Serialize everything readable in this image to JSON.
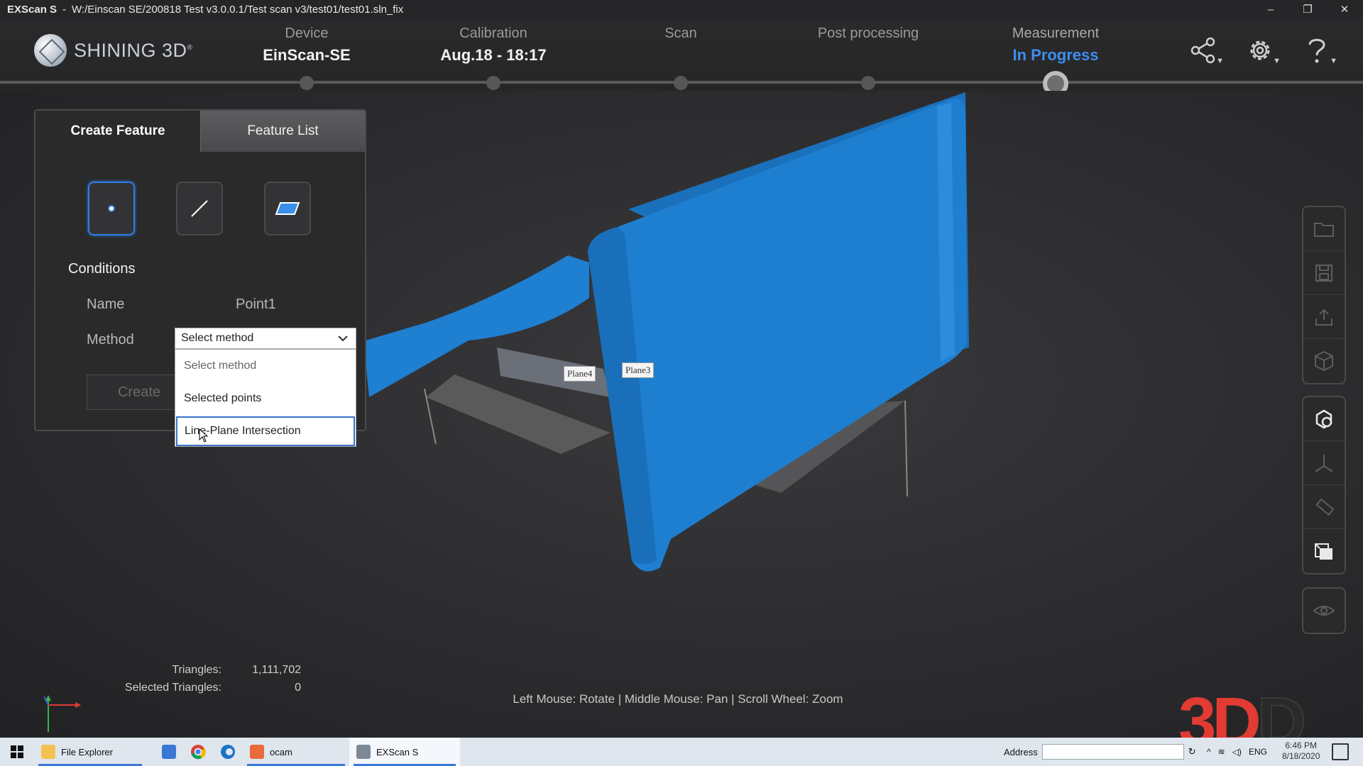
{
  "window": {
    "app_name": "EXScan S",
    "separator": "-",
    "path": "W:/Einscan SE/200818 Test v3.0.0.1/Test scan v3/test01/test01.sln_fix",
    "min": "–",
    "max": "❐",
    "close": "✕"
  },
  "logo": {
    "text": "SHINING 3D",
    "mark": "®"
  },
  "steps": [
    {
      "label": "Device",
      "value": "EinScan-SE"
    },
    {
      "label": "Calibration",
      "value": "Aug.18 - 18:17"
    },
    {
      "label": "Scan",
      "value": ""
    },
    {
      "label": "Post processing",
      "value": ""
    },
    {
      "label": "Measurement",
      "value": "In Progress"
    }
  ],
  "header_icons": [
    "share-icon",
    "gear-icon",
    "help-icon"
  ],
  "feature_panel": {
    "tabs": [
      "Create Feature",
      "Feature List"
    ],
    "types": [
      "point-icon",
      "line-icon",
      "plane-icon"
    ],
    "selected_type": "point-icon",
    "conditions_label": "Conditions",
    "name_label": "Name",
    "name_value": "Point1",
    "method_label": "Method",
    "create_label": "Create"
  },
  "method_dropdown": {
    "selected": "Select method",
    "options": [
      "Select method",
      "Selected points",
      "Line-Plane Intersection"
    ],
    "hovered": "Line-Plane Intersection"
  },
  "plane_labels": [
    "Plane4",
    "Plane3"
  ],
  "right_toolbar": {
    "group1": [
      "folder-icon",
      "save-icon",
      "export-icon",
      "cube-icon"
    ],
    "group2": [
      "select-icon",
      "axes-icon",
      "measure-icon",
      "view-cube-icon"
    ],
    "group3": [
      "eye-icon"
    ]
  },
  "stats": {
    "triangles_label": "Triangles:",
    "triangles_value": "1,111,702",
    "selected_label": "Selected Triangles:",
    "selected_value": "0"
  },
  "hint": "Left Mouse: Rotate | Middle Mouse: Pan | Scroll Wheel: Zoom",
  "watermark": {
    "part1": "3",
    "part2": "D",
    "part3": "D"
  },
  "colors": {
    "accent": "#3d8ef0",
    "model_blue": "#1e7fd0",
    "watermark_red": "#e23b34"
  },
  "taskbar": {
    "items": [
      "File Explorer",
      "",
      "",
      "",
      "ocam",
      "EXScan S"
    ],
    "address_label": "Address",
    "lang": "ENG",
    "time": "6:46 PM",
    "date": "8/18/2020"
  }
}
